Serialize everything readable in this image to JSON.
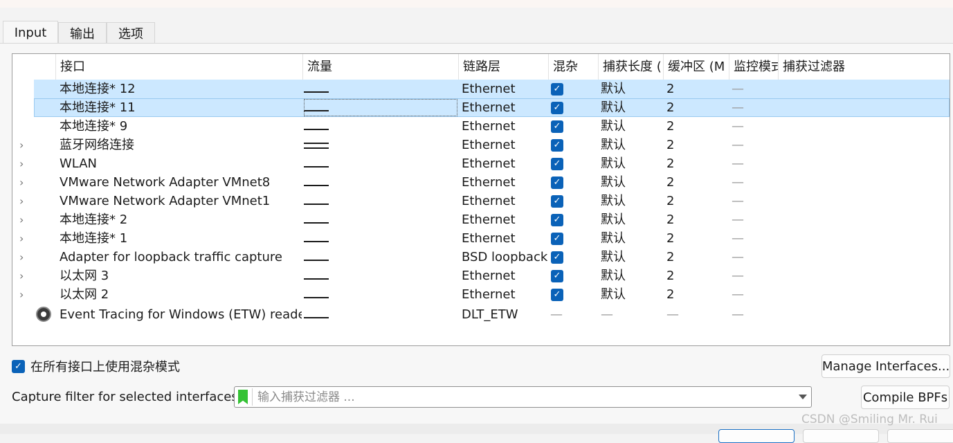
{
  "tabs": [
    {
      "label": "Input",
      "active": true
    },
    {
      "label": "输出",
      "active": false
    },
    {
      "label": "选项",
      "active": false
    }
  ],
  "table": {
    "columns": [
      "接口",
      "流量",
      "链路层",
      "混杂",
      "捕获长度 (",
      "缓冲区 (M",
      "监控模式",
      "捕获过滤器"
    ],
    "rows": [
      {
        "name": "本地连接* 12",
        "link": "Ethernet",
        "promisc": true,
        "snaplen": "默认",
        "buffer": "2",
        "monitor": "—",
        "expander": false,
        "selected": true
      },
      {
        "name": "本地连接* 11",
        "link": "Ethernet",
        "promisc": true,
        "snaplen": "默认",
        "buffer": "2",
        "monitor": "—",
        "expander": false,
        "selected": true,
        "focused": true
      },
      {
        "name": "本地连接* 9",
        "link": "Ethernet",
        "promisc": true,
        "snaplen": "默认",
        "buffer": "2",
        "monitor": "—",
        "expander": false
      },
      {
        "name": "蓝牙网络连接",
        "link": "Ethernet",
        "promisc": true,
        "snaplen": "默认",
        "buffer": "2",
        "monitor": "—",
        "expander": true,
        "double_traffic": true
      },
      {
        "name": "WLAN",
        "link": "Ethernet",
        "promisc": true,
        "snaplen": "默认",
        "buffer": "2",
        "monitor": "—",
        "expander": true
      },
      {
        "name": "VMware Network Adapter VMnet8",
        "link": "Ethernet",
        "promisc": true,
        "snaplen": "默认",
        "buffer": "2",
        "monitor": "—",
        "expander": true
      },
      {
        "name": "VMware Network Adapter VMnet1",
        "link": "Ethernet",
        "promisc": true,
        "snaplen": "默认",
        "buffer": "2",
        "monitor": "—",
        "expander": true
      },
      {
        "name": "本地连接* 2",
        "link": "Ethernet",
        "promisc": true,
        "snaplen": "默认",
        "buffer": "2",
        "monitor": "—",
        "expander": true
      },
      {
        "name": "本地连接* 1",
        "link": "Ethernet",
        "promisc": true,
        "snaplen": "默认",
        "buffer": "2",
        "monitor": "—",
        "expander": true
      },
      {
        "name": "Adapter for loopback traffic capture",
        "link": "BSD loopback",
        "promisc": true,
        "snaplen": "默认",
        "buffer": "2",
        "monitor": "—",
        "expander": true
      },
      {
        "name": "以太网 3",
        "link": "Ethernet",
        "promisc": true,
        "snaplen": "默认",
        "buffer": "2",
        "monitor": "—",
        "expander": true
      },
      {
        "name": "以太网 2",
        "link": "Ethernet",
        "promisc": true,
        "snaplen": "默认",
        "buffer": "2",
        "monitor": "—",
        "expander": true
      },
      {
        "name": "Event Tracing for Windows (ETW) reader",
        "link": "DLT_ETW",
        "promisc": null,
        "promisc_text": "—",
        "snaplen": "—",
        "buffer": "—",
        "monitor": "—",
        "expander": false,
        "gear_icon": true
      }
    ]
  },
  "promiscuous_all": {
    "label": "在所有接口上使用混杂模式",
    "checked": true
  },
  "manage_button": "Manage Interfaces...",
  "capture_filter": {
    "label": "Capture filter for selected interfaces:",
    "placeholder": "输入捕获过滤器 ...",
    "value": ""
  },
  "compile_button": "Compile BPFs",
  "watermark": "CSDN @Smiling Mr. Rui",
  "colors": {
    "accent": "#0a62b8",
    "selection": "#cce8ff",
    "filter_ok": "#35c235"
  },
  "icons": {
    "checkbox": "checkmark-icon",
    "expander": "chevron-right-icon",
    "etw": "gear-icon",
    "filter": "bookmark-icon",
    "dropdown": "chevron-down-icon"
  }
}
